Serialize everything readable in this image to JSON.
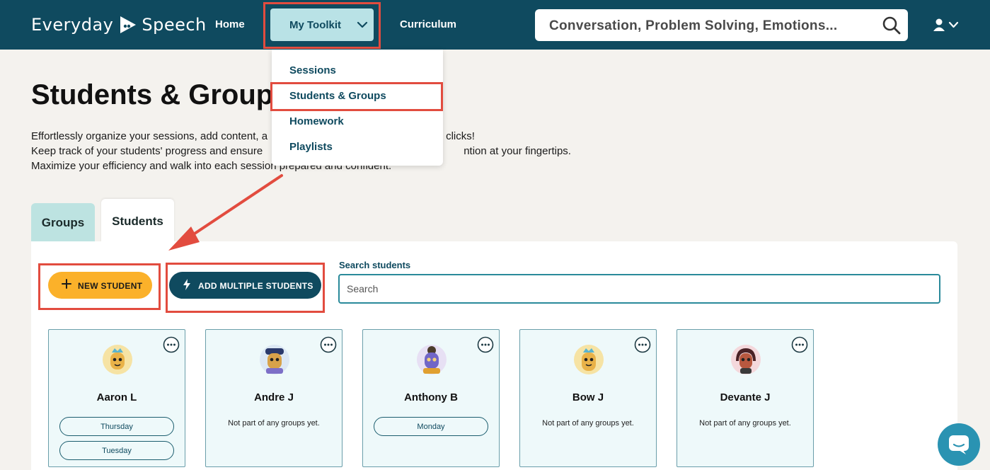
{
  "header": {
    "logo_left": "Everyday",
    "logo_right": "Speech",
    "nav": {
      "home": "Home",
      "toolkit": "My Toolkit",
      "curriculum": "Curriculum"
    },
    "search_placeholder": "Conversation, Problem Solving, Emotions...",
    "icons": {
      "search": "search-icon",
      "user": "user-icon",
      "chevron": "chevron-down-icon"
    }
  },
  "toolkit_menu": {
    "items": [
      "Sessions",
      "Students & Groups",
      "Homework",
      "Playlists"
    ]
  },
  "page": {
    "title": "Students & Groups",
    "intro": [
      "Effortlessly organize your sessions, add content, a",
      "clicks!",
      "Keep track of your students' progress and ensure",
      "ntion at your fingertips.",
      "Maximize your efficiency and walk into each session prepared and confident."
    ]
  },
  "tabs": {
    "groups": "Groups",
    "students": "Students",
    "active": "Students"
  },
  "toolbar": {
    "new_student": "NEW STUDENT",
    "add_multiple": "ADD MULTIPLE STUDENTS",
    "search_label": "Search students",
    "search_placeholder": "Search"
  },
  "students": [
    {
      "name": "Aaron L",
      "groups": [
        "Thursday",
        "Tuesday"
      ],
      "no_groups_text": ""
    },
    {
      "name": "Andre J",
      "groups": [],
      "no_groups_text": "Not part of any groups yet."
    },
    {
      "name": "Anthony B",
      "groups": [
        "Monday"
      ],
      "no_groups_text": ""
    },
    {
      "name": "Bow J",
      "groups": [],
      "no_groups_text": "Not part of any groups yet."
    },
    {
      "name": "Devante J",
      "groups": [],
      "no_groups_text": "Not part of any groups yet."
    }
  ],
  "colors": {
    "header_bg": "#0f4a5f",
    "accent_yellow": "#fbb12a",
    "annotation_red": "#e24c3f",
    "card_bg": "#eef9fa",
    "chat_button": "#2a93b2"
  }
}
